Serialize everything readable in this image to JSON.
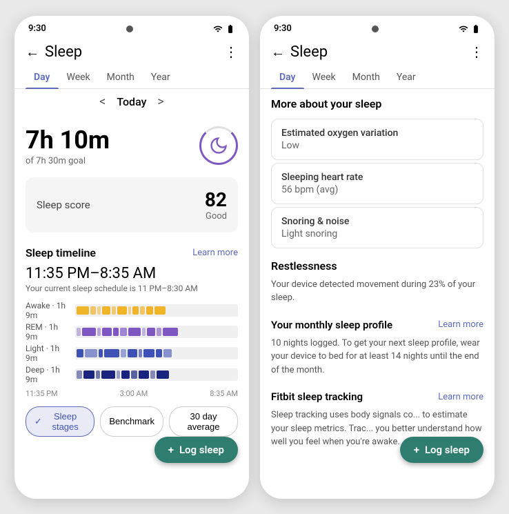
{
  "status_bar": {
    "time": "9:30",
    "icons": [
      "wifi",
      "signal",
      "battery"
    ]
  },
  "left_phone": {
    "header": {
      "back_label": "←",
      "title": "Sleep",
      "more_label": "⋮"
    },
    "tabs": [
      "Day",
      "Week",
      "Month",
      "Year"
    ],
    "active_tab": "Day",
    "date_nav": {
      "prev_label": "<",
      "current": "Today",
      "next_label": ">"
    },
    "sleep_duration": {
      "hours": "7h",
      "minutes": "10m",
      "goal": "of 7h 30m goal"
    },
    "score_card": {
      "label": "Sleep score",
      "value": "82",
      "description": "Good"
    },
    "timeline": {
      "section_title": "Sleep timeline",
      "learn_more": "Learn more",
      "time_range": "11:35 PM–8:35 AM",
      "schedule_note": "Your current sleep schedule is 11 PM–8:30 AM",
      "rows": [
        {
          "label": "Awake · 1h 9m",
          "color": "awake"
        },
        {
          "label": "REM · 1h 9m",
          "color": "rem"
        },
        {
          "label": "Light · 1h 9m",
          "color": "light"
        },
        {
          "label": "Deep · 1h 9m",
          "color": "deep"
        }
      ],
      "time_markers": [
        "11:35 PM",
        "3:00 AM",
        "8:35 AM"
      ]
    },
    "bottom_buttons": [
      {
        "label": "Sleep stages",
        "active": true,
        "icon": "✓"
      },
      {
        "label": "Benchmark",
        "active": false
      },
      {
        "label": "30 day average",
        "active": false
      }
    ],
    "log_sleep_fab": "+ Log sleep"
  },
  "right_phone": {
    "header": {
      "back_label": "←",
      "title": "Sleep",
      "more_label": "⋮"
    },
    "tabs": [
      "Day",
      "Week",
      "Month",
      "Year"
    ],
    "active_tab": "Day",
    "more_sleep_title": "More about your sleep",
    "info_cards": [
      {
        "title": "Estimated oxygen variation",
        "value": "Low"
      },
      {
        "title": "Sleeping heart rate",
        "value": "56 bpm (avg)"
      },
      {
        "title": "Snoring & noise",
        "value": "Light snoring"
      }
    ],
    "restlessness": {
      "title": "Restlessness",
      "text": "Your device detected movement during 23% of your sleep."
    },
    "monthly_profile": {
      "title": "Your monthly sleep profile",
      "learn_more": "Learn more",
      "text": "10 nights logged. To get your next sleep profile, wear your device to bed for at least 14 nights until the end of the month."
    },
    "fitbit_tracking": {
      "title": "Fitbit sleep tracking",
      "learn_more": "Learn more",
      "text": "Sleep tracking uses body signals co... to estimate your sleep metrics. Trac... you better understand how well you feel when you're awake."
    },
    "log_sleep_fab": "+ Log sleep"
  }
}
